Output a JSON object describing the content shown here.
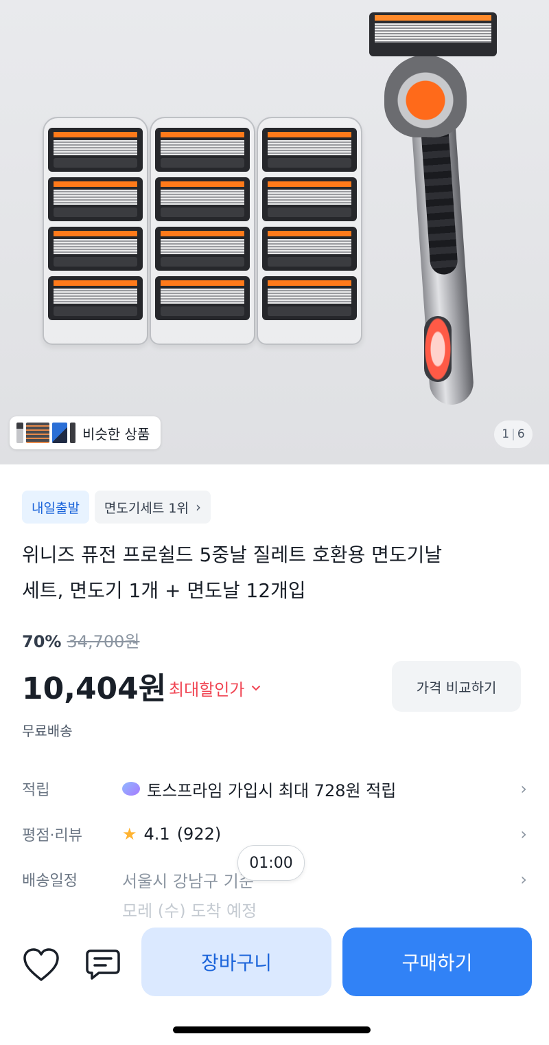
{
  "gallery": {
    "similar_label": "비슷한 상품",
    "page_current": "1",
    "page_total": "6"
  },
  "tags": {
    "delivery": "내일출발",
    "ranking": "면도기세트 1위"
  },
  "product": {
    "title_line1": "위니즈 퓨전 프로쉴드 5중날 질레트 호환용 면도기날",
    "title_line2": "세트, 면도기 1개 + 면도날 12개입",
    "discount_rate": "70%",
    "original_price": "34,700원",
    "price": "10,404원",
    "max_discount_label": "최대할인가",
    "compare_button": "가격 비교하기",
    "shipping": "무료배송"
  },
  "info_rows": {
    "points_label": "적립",
    "points_value": "토스프라임 가입시 최대 728원 적립",
    "rating_label": "평점·리뷰",
    "rating_score": "4.1",
    "rating_count": "(922)",
    "delivery_label": "배송일정",
    "delivery_value": "서울시 강남구 기준",
    "delivery_date_partial": "모레 (수) 도착 예정"
  },
  "countdown": "01:00",
  "bottom_bar": {
    "cart_button": "장바구니",
    "buy_button": "구매하기"
  },
  "colors": {
    "primary": "#3182f6",
    "primary_light": "#dbe9ff",
    "discount_red": "#f04452",
    "delivery_tag_bg": "#e8f3ff"
  },
  "icons": [
    "heart-icon",
    "chat-icon",
    "chevron-right-icon",
    "chevron-down-icon",
    "star-icon",
    "toss-prime-icon"
  ]
}
